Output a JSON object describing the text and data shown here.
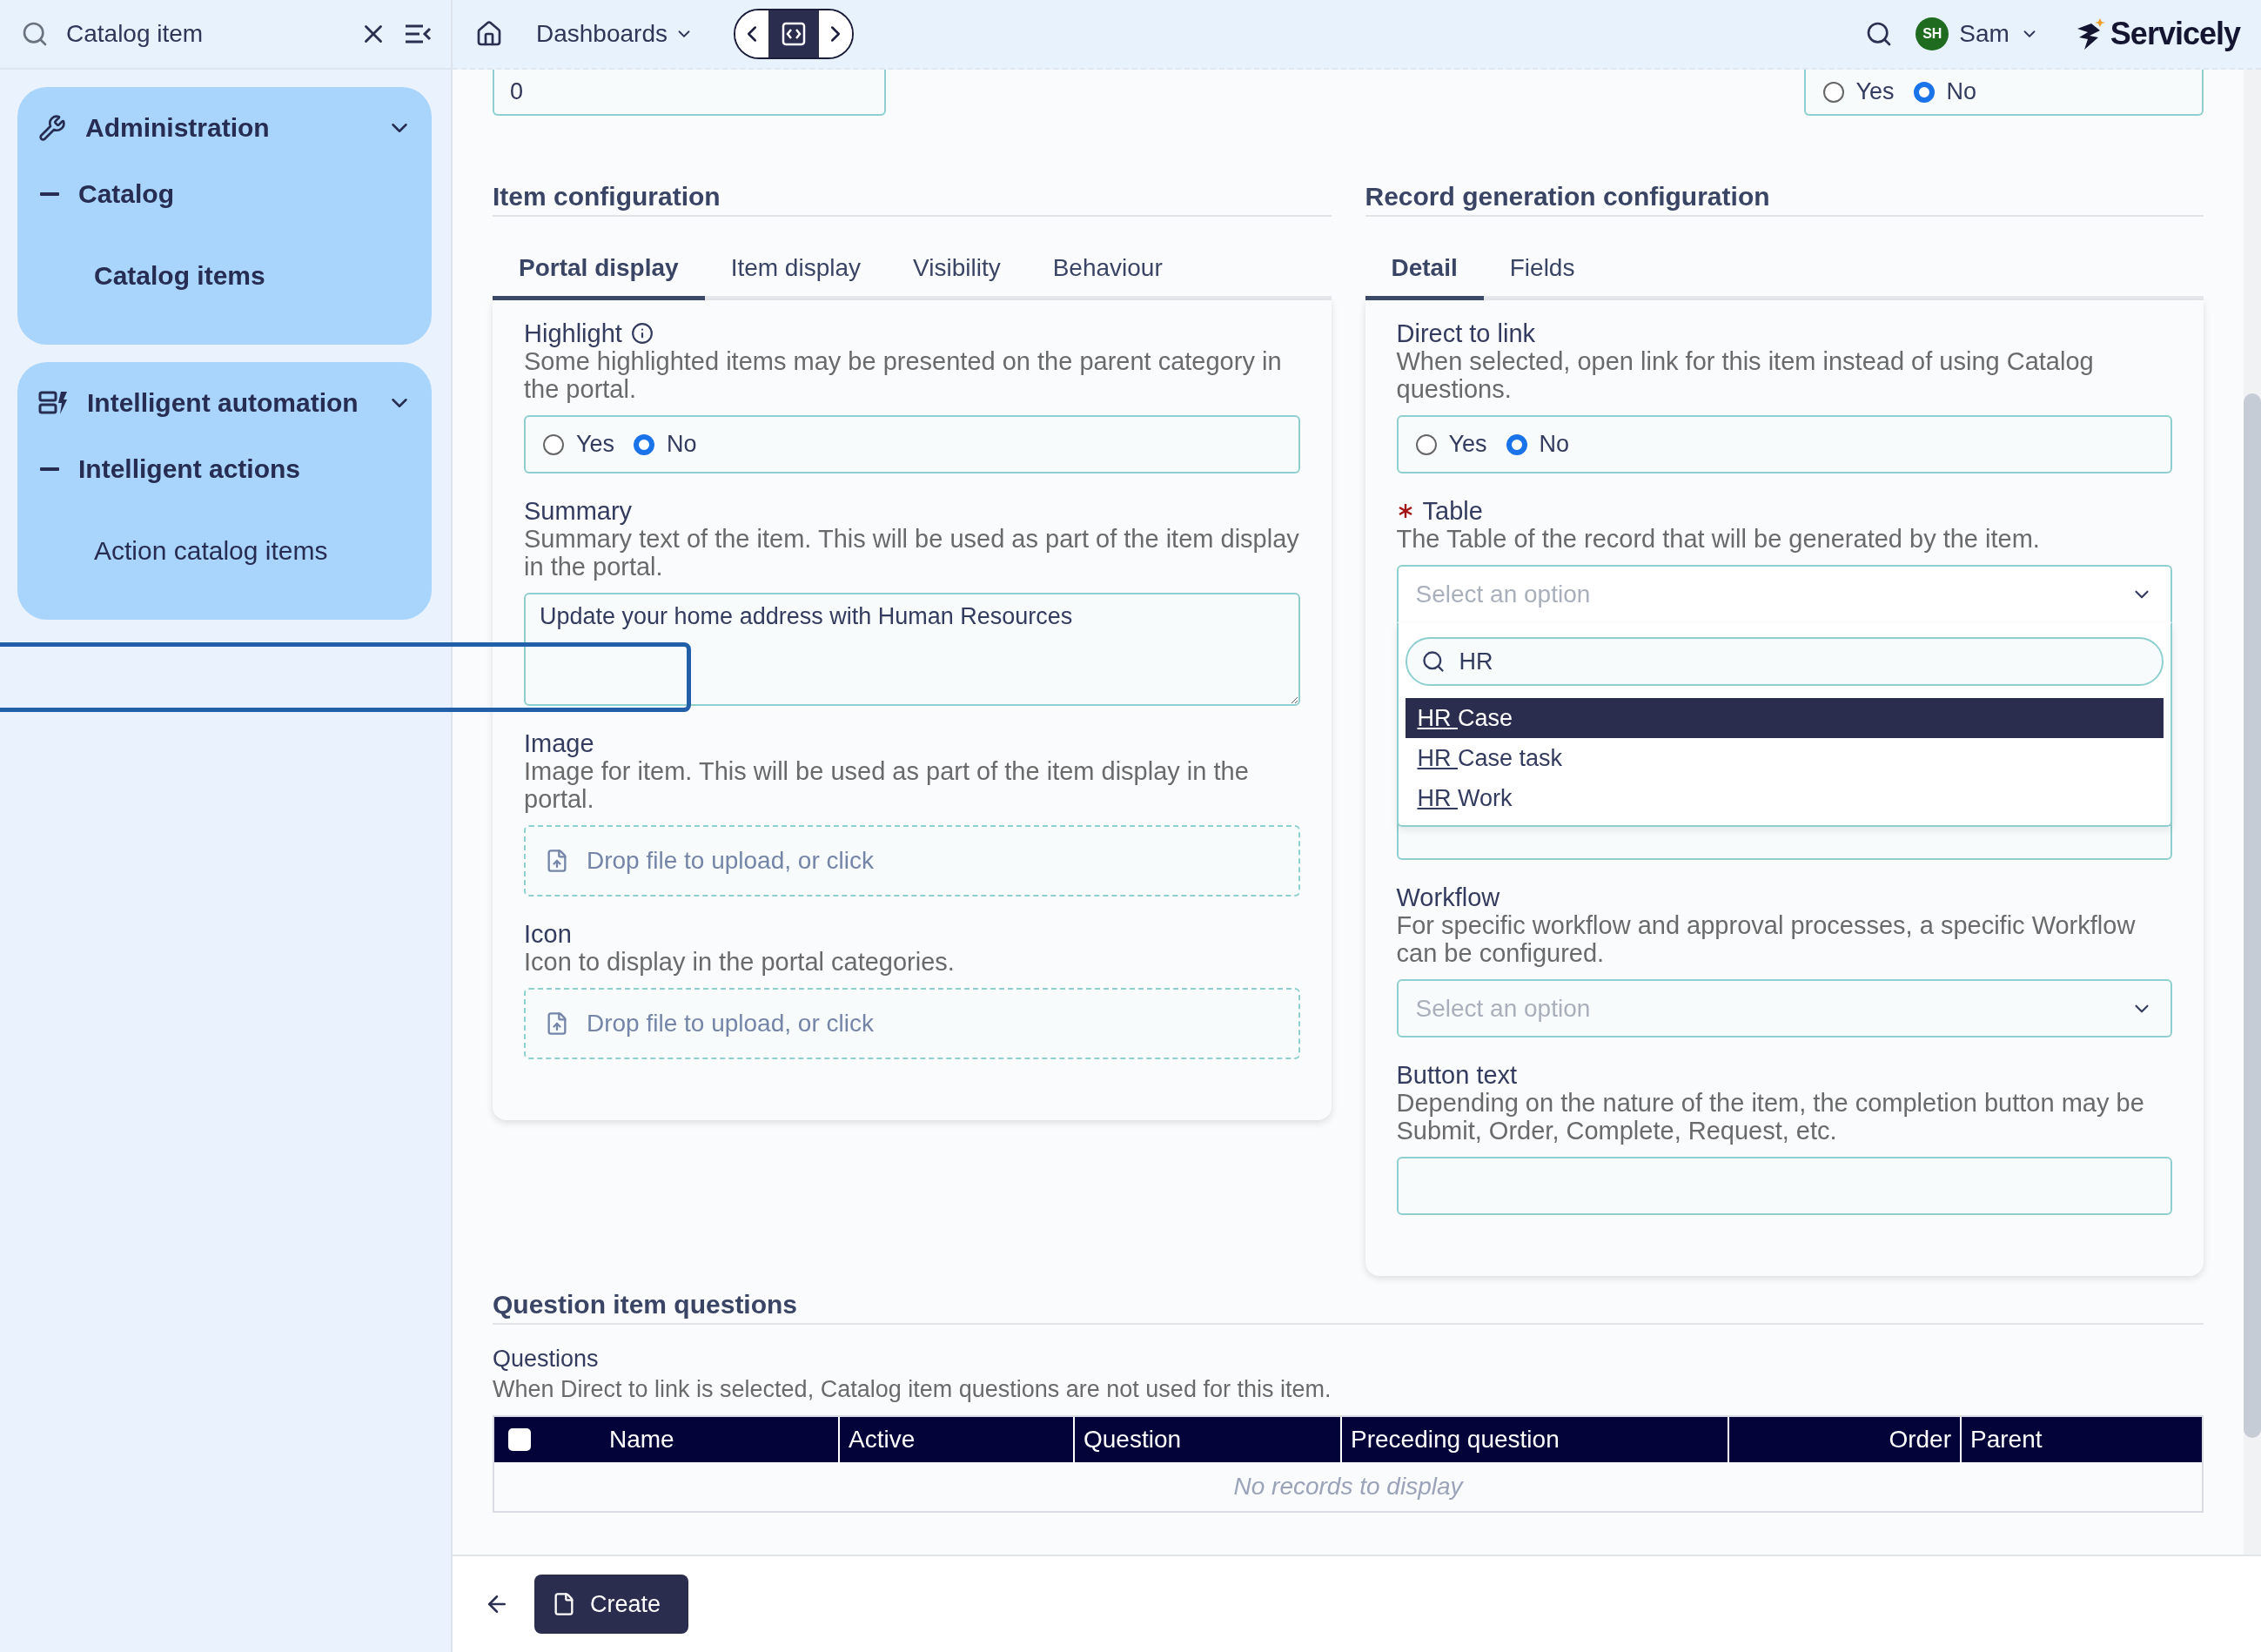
{
  "search": {
    "value": "Catalog item"
  },
  "topbar": {
    "dashboards": "Dashboards",
    "user": {
      "initials": "SH",
      "name": "Sam"
    },
    "brand": "Servicely"
  },
  "sidebar": {
    "groups": [
      {
        "label": "Administration",
        "expanded": true,
        "children": [
          {
            "label": "Catalog",
            "expanded": true,
            "children": [
              {
                "label": "Catalog items",
                "selected": true
              }
            ]
          }
        ]
      },
      {
        "label": "Intelligent automation",
        "expanded": true,
        "children": [
          {
            "label": "Intelligent actions",
            "expanded": true,
            "children": [
              {
                "label": "Action catalog items",
                "selected": false
              }
            ]
          }
        ]
      }
    ]
  },
  "top_fields": [
    {
      "kind": "text",
      "value": "0"
    },
    {
      "kind": "radio",
      "options": [
        {
          "label": "Yes",
          "selected": false
        },
        {
          "label": "No",
          "selected": true
        }
      ]
    }
  ],
  "item_configuration": {
    "title": "Item configuration",
    "tabs": [
      {
        "label": "Portal display",
        "selected": true
      },
      {
        "label": "Item display",
        "selected": false
      },
      {
        "label": "Visibility",
        "selected": false
      },
      {
        "label": "Behaviour",
        "selected": false
      }
    ],
    "fields": [
      {
        "kind": "radio",
        "label": "Highlight",
        "info": true,
        "description": "Some highlighted items may be presented on the parent category in the portal.",
        "options": [
          {
            "label": "Yes",
            "selected": false
          },
          {
            "label": "No",
            "selected": true
          }
        ]
      },
      {
        "kind": "textarea",
        "label": "Summary",
        "description": "Summary text of the item. This will be used as part of the item display in the portal.",
        "value": "Update your home address with Human Resources"
      },
      {
        "kind": "upload",
        "label": "Image",
        "description": "Image for item. This will be used as part of the item display in the portal.",
        "placeholder": "Drop file to upload, or click"
      },
      {
        "kind": "upload",
        "label": "Icon",
        "description": "Icon to display in the portal categories.",
        "placeholder": "Drop file to upload, or click"
      }
    ]
  },
  "record_generation": {
    "title": "Record generation configuration",
    "tabs": [
      {
        "label": "Detail",
        "selected": true
      },
      {
        "label": "Fields",
        "selected": false
      }
    ],
    "fields": [
      {
        "kind": "radio",
        "label": "Direct to link",
        "description": "When selected, open link for this item instead of using Catalog questions.",
        "options": [
          {
            "label": "Yes",
            "selected": false
          },
          {
            "label": "No",
            "selected": true
          }
        ]
      },
      {
        "kind": "select",
        "label": "Table",
        "required": true,
        "description": "The Table of the record that will be generated by the item.",
        "placeholder": "Select an option",
        "expanded": true,
        "search": "HR",
        "options": [
          {
            "match": "HR ",
            "rest": "Case",
            "selected": true
          },
          {
            "match": "HR ",
            "rest": "Case task",
            "selected": false
          },
          {
            "match": "HR ",
            "rest": "Work",
            "selected": false
          }
        ]
      },
      {
        "kind": "covered"
      },
      {
        "kind": "select",
        "label": "Workflow",
        "description": "For specific workflow and approval processes, a specific Workflow can be configured.",
        "placeholder": "Select an option",
        "expanded": false
      },
      {
        "kind": "text",
        "label": "Button text",
        "description": "Depending on the nature of the item, the completion button may be Submit, Order, Complete, Request, etc."
      }
    ]
  },
  "questions": {
    "title": "Question item questions",
    "label": "Questions",
    "description": "When Direct to link is selected, Catalog item questions are not used for this item.",
    "table": {
      "select_all": {
        "checked": false
      },
      "columns": [
        {
          "label": "Name",
          "kind": "text"
        },
        {
          "label": "Active",
          "kind": "text"
        },
        {
          "label": "Question",
          "kind": "text"
        },
        {
          "label": "Preceding question",
          "kind": "text"
        },
        {
          "label": "Order",
          "kind": "number"
        },
        {
          "label": "Parent",
          "kind": "text"
        }
      ],
      "empty": "No records to display"
    }
  },
  "footer": {
    "create": "Create"
  }
}
